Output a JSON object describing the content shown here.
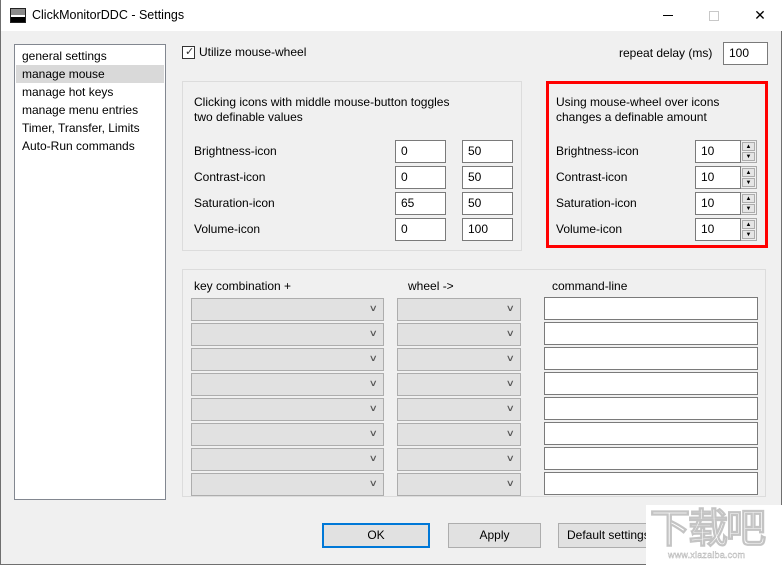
{
  "window": {
    "title": "ClickMonitorDDC - Settings",
    "app_icon": "monitor-icon",
    "controls": {
      "minimize": "minimize-icon",
      "maximize": "maximize-icon",
      "close": "close-icon"
    }
  },
  "sidebar": {
    "items": [
      {
        "label": "general settings",
        "selected": false
      },
      {
        "label": "manage mouse",
        "selected": true
      },
      {
        "label": "manage hot keys",
        "selected": false
      },
      {
        "label": "manage menu entries",
        "selected": false
      },
      {
        "label": "Timer, Transfer, Limits",
        "selected": false
      },
      {
        "label": "Auto-Run commands",
        "selected": false
      }
    ]
  },
  "mouse_wheel": {
    "checkbox_label": "Utilize mouse-wheel",
    "checked": true,
    "repeat_delay_label": "repeat delay (ms)",
    "repeat_delay_value": "100"
  },
  "middle_button_group": {
    "description_line1": "Clicking icons with middle mouse-button toggles",
    "description_line2": "two definable values",
    "rows": [
      {
        "label": "Brightness-icon",
        "value1": "0",
        "value2": "50"
      },
      {
        "label": "Contrast-icon",
        "value1": "0",
        "value2": "50"
      },
      {
        "label": "Saturation-icon",
        "value1": "65",
        "value2": "50"
      },
      {
        "label": "Volume-icon",
        "value1": "0",
        "value2": "100"
      }
    ]
  },
  "wheel_group": {
    "description_line1": "Using mouse-wheel over icons",
    "description_line2": "changes a definable amount",
    "highlight_color": "#ff0000",
    "rows": [
      {
        "label": "Brightness-icon",
        "value": "10"
      },
      {
        "label": "Contrast-icon",
        "value": "10"
      },
      {
        "label": "Saturation-icon",
        "value": "10"
      },
      {
        "label": "Volume-icon",
        "value": "10"
      }
    ]
  },
  "command_table": {
    "headers": {
      "key_combination": "key combination  +",
      "wheel": "wheel  ->",
      "command_line": "command-line"
    },
    "rows": [
      {
        "key": "",
        "wheel": "",
        "command": ""
      },
      {
        "key": "",
        "wheel": "",
        "command": ""
      },
      {
        "key": "",
        "wheel": "",
        "command": ""
      },
      {
        "key": "",
        "wheel": "",
        "command": ""
      },
      {
        "key": "",
        "wheel": "",
        "command": ""
      },
      {
        "key": "",
        "wheel": "",
        "command": ""
      },
      {
        "key": "",
        "wheel": "",
        "command": ""
      },
      {
        "key": "",
        "wheel": "",
        "command": ""
      }
    ]
  },
  "buttons": {
    "ok": "OK",
    "apply": "Apply",
    "default_settings": "Default settings"
  },
  "watermark": {
    "glyphs": "下载吧",
    "url": "www.xiazaiba.com"
  },
  "colors": {
    "accent_focus": "#0078d7",
    "highlight_border": "#ff0000",
    "selected_item_bg": "#d9d9d9"
  }
}
